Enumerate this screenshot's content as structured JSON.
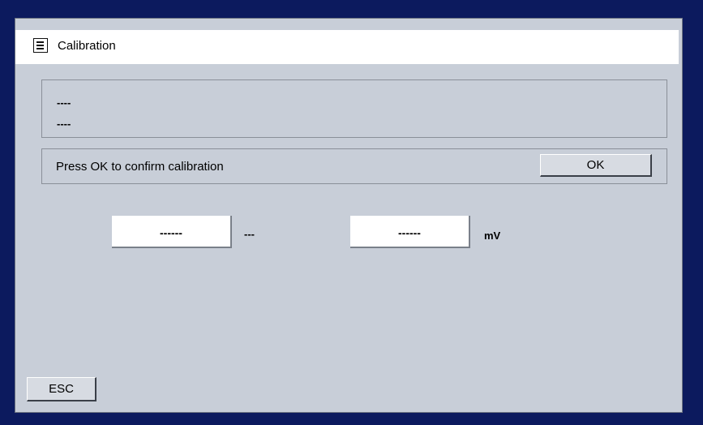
{
  "window": {
    "title": "Calibration",
    "menu_icon": "menu-icon"
  },
  "info": {
    "line1": "----",
    "line2": "----"
  },
  "confirm": {
    "message": "Press OK to confirm calibration",
    "ok_label": "OK"
  },
  "fields": [
    {
      "value": "------",
      "unit": "---"
    },
    {
      "value": "------",
      "unit": "mV"
    }
  ],
  "footer": {
    "esc_label": "ESC"
  },
  "colors": {
    "frame": "#0c1a5e",
    "panel": "#c8ced8",
    "titlebar": "#ffffff"
  }
}
